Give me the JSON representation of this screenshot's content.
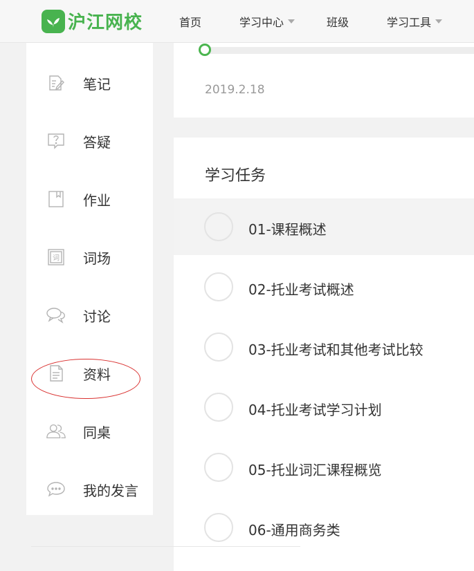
{
  "header": {
    "logo_text": "沪江网校",
    "nav": [
      {
        "label": "首页",
        "has_dropdown": false
      },
      {
        "label": "学习中心",
        "has_dropdown": true
      },
      {
        "label": "班级",
        "has_dropdown": false
      },
      {
        "label": "学习工具",
        "has_dropdown": true
      }
    ]
  },
  "sidebar": {
    "items": [
      {
        "label": "笔记",
        "icon": "note-edit-icon"
      },
      {
        "label": "答疑",
        "icon": "question-icon"
      },
      {
        "label": "作业",
        "icon": "homework-icon"
      },
      {
        "label": "词场",
        "icon": "vocab-icon"
      },
      {
        "label": "讨论",
        "icon": "discussion-icon"
      },
      {
        "label": "资料",
        "icon": "document-icon",
        "highlighted": true
      },
      {
        "label": "同桌",
        "icon": "deskmates-icon"
      },
      {
        "label": "我的发言",
        "icon": "comment-icon"
      }
    ]
  },
  "progress": {
    "date": "2019.2.18",
    "accent_color": "#4bb54f"
  },
  "tasks": {
    "title": "学习任务",
    "items": [
      {
        "label": "01-课程概述",
        "active": true
      },
      {
        "label": "02-托业考试概述",
        "active": false
      },
      {
        "label": "03-托业考试和其他考试比较",
        "active": false
      },
      {
        "label": "04-托业考试学习计划",
        "active": false
      },
      {
        "label": "05-托业词汇课程概览",
        "active": false
      },
      {
        "label": "06-通用商务类",
        "active": false
      }
    ]
  },
  "colors": {
    "brand": "#48b34f",
    "highlight_ring": "#d9302f"
  }
}
